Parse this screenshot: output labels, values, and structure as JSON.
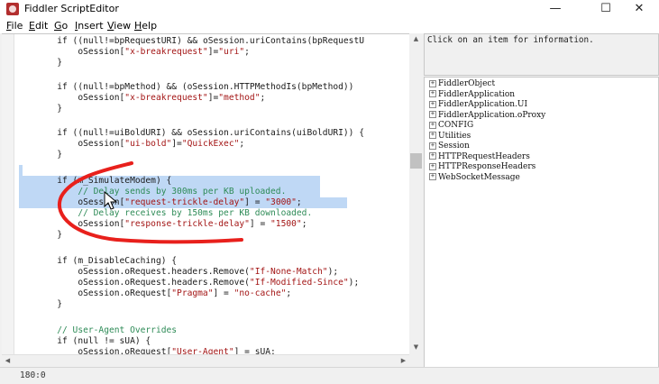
{
  "window": {
    "title": "Fiddler ScriptEditor",
    "minimize": "—",
    "maximize": "☐",
    "close": "✕"
  },
  "menu": [
    {
      "label_u": "F",
      "label_rest": "ile"
    },
    {
      "label_u": "E",
      "label_rest": "dit"
    },
    {
      "label_u": "G",
      "label_rest": "o"
    },
    {
      "label_u": "I",
      "label_rest": "nsert"
    },
    {
      "label_u": "V",
      "label_rest": "iew"
    },
    {
      "label_u": "H",
      "label_rest": "elp"
    }
  ],
  "code": {
    "l01": {
      "a": "if ((null!=bpRequestURI) && oSession.uriContains(bpRequestU"
    },
    "l02": {
      "a": "oSession[",
      "s": "\"x-breakrequest\"",
      "b": "]=",
      "t": "\"uri\"",
      "c": ";"
    },
    "l03": {
      "a": "}"
    },
    "l04": {
      "a": "if ((null!=bpMethod) && (oSession.HTTPMethodIs(bpMethod))"
    },
    "l05": {
      "a": "oSession[",
      "s": "\"x-breakrequest\"",
      "b": "]=",
      "t": "\"method\"",
      "c": ";"
    },
    "l06": {
      "a": "}"
    },
    "l07": {
      "a": "if ((null!=uiBoldURI) && oSession.uriContains(uiBoldURI)) {"
    },
    "l08": {
      "a": "oSession[",
      "s": "\"ui-bold\"",
      "b": "]=",
      "t": "\"QuickExec\"",
      "c": ";"
    },
    "l09": {
      "a": "}"
    },
    "l10": {
      "a": "if (m_SimulateModem) {"
    },
    "l11": {
      "cm": "// Delay sends by 300ms per KB uploaded."
    },
    "l12": {
      "a": "oSession[",
      "s": "\"request-trickle-delay\"",
      "b": "] = ",
      "t": "\"3000\"",
      "c": ";"
    },
    "l13": {
      "cm": "// Delay receives by 150ms per KB downloaded."
    },
    "l14": {
      "a": "oSession[",
      "s": "\"response-trickle-delay\"",
      "b": "] = ",
      "t": "\"1500\"",
      "c": ";"
    },
    "l15": {
      "a": "}"
    },
    "l16": {
      "a": "if (m_DisableCaching) {"
    },
    "l17": {
      "a": "oSession.oRequest.headers.Remove(",
      "s": "\"If-None-Match\"",
      "c": ");"
    },
    "l18": {
      "a": "oSession.oRequest.headers.Remove(",
      "s": "\"If-Modified-Since\"",
      "c": ");"
    },
    "l19": {
      "a": "oSession.oRequest[",
      "s": "\"Pragma\"",
      "b": "] = ",
      "t": "\"no-cache\"",
      "c": ";"
    },
    "l20": {
      "a": "}"
    },
    "l21": {
      "cm": "// User-Agent Overrides"
    },
    "l22": {
      "a": "if (null != sUA) {"
    },
    "l23": {
      "a": "oSession.oRequest[",
      "s": "\"User-Agent\"",
      "b": "] = sUA;"
    }
  },
  "info_text": "Click on an item for information.",
  "tree_items": [
    "FiddlerObject",
    "FiddlerApplication",
    "FiddlerApplication.UI",
    "FiddlerApplication.oProxy",
    "CONFIG",
    "Utilities",
    "Session",
    "HTTPRequestHeaders",
    "HTTPResponseHeaders",
    "WebSocketMessage"
  ],
  "status": {
    "position": "180:0"
  },
  "colors": {
    "selection": "#bfd8f5",
    "annotation": "#e8201c",
    "comment": "#2e8b57",
    "string": "#a31515"
  }
}
